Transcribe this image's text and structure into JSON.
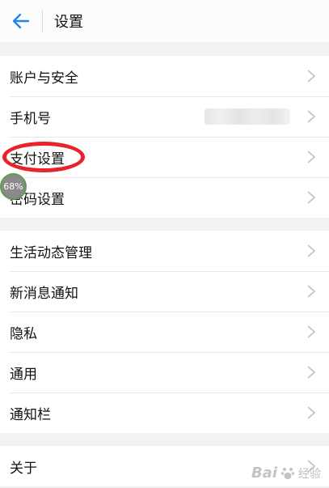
{
  "header": {
    "title": "设置"
  },
  "groups": [
    {
      "items": [
        {
          "label": "账户与安全"
        },
        {
          "label": "手机号"
        },
        {
          "label": "支付设置"
        },
        {
          "label": "密码设置"
        }
      ]
    },
    {
      "items": [
        {
          "label": "生活动态管理"
        },
        {
          "label": "新消息通知"
        },
        {
          "label": "隐私"
        },
        {
          "label": "通用"
        },
        {
          "label": "通知栏"
        }
      ]
    },
    {
      "items": [
        {
          "label": "关于"
        }
      ]
    }
  ],
  "overlay": {
    "progress_text": "68%",
    "annotation_color": "#e8232a"
  },
  "watermark": {
    "logo_text": "Bai",
    "suffix_text": "经验"
  },
  "colors": {
    "accent": "#1e88e5",
    "background": "#f2f2f2"
  }
}
